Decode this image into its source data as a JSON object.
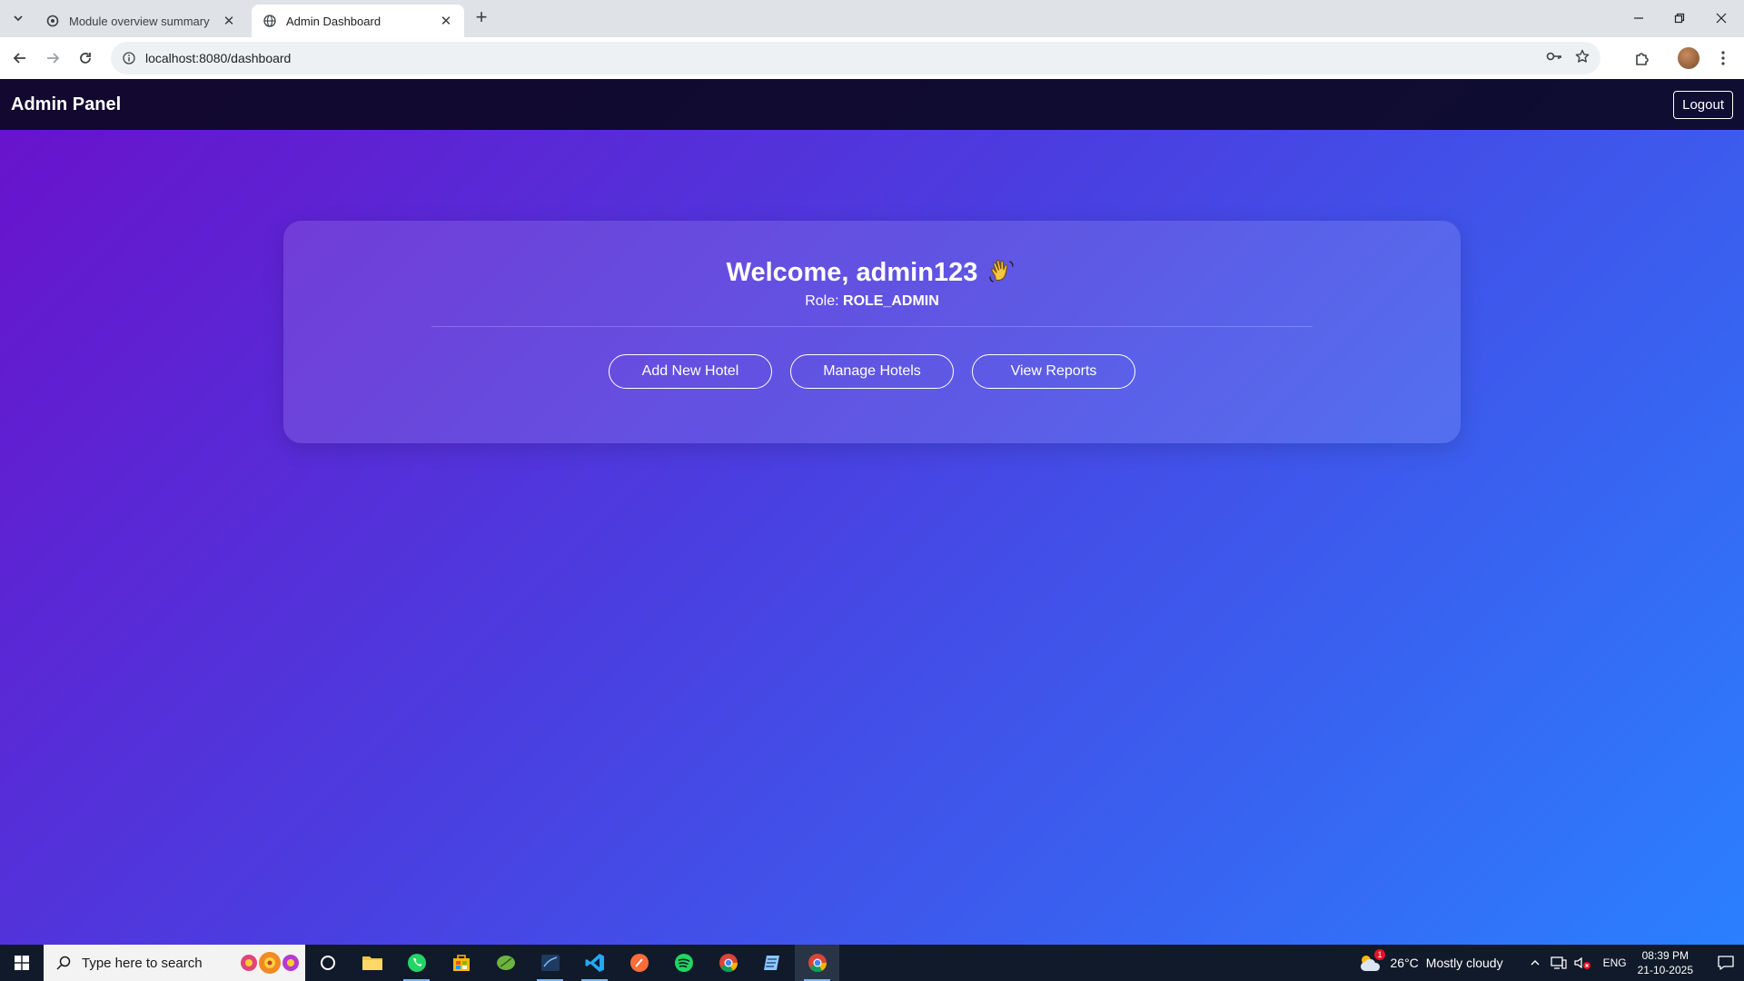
{
  "browser": {
    "tabs": [
      {
        "title": "Module overview summary",
        "active": false
      },
      {
        "title": "Admin Dashboard",
        "active": true
      }
    ],
    "url": "localhost:8080/dashboard"
  },
  "navbar": {
    "brand": "Admin Panel",
    "logout_label": "Logout"
  },
  "dashboard": {
    "welcome_text": "Welcome, admin123",
    "role_label": "Role:",
    "role_value": "ROLE_ADMIN",
    "actions": [
      {
        "label": "Add New Hotel"
      },
      {
        "label": "Manage Hotels"
      },
      {
        "label": "View Reports"
      }
    ]
  },
  "taskbar": {
    "search_placeholder": "Type here to search",
    "weather_temp": "26°C",
    "weather_desc": "Mostly cloudy",
    "weather_badge": "1",
    "language": "ENG",
    "time": "08:39 PM",
    "date": "21-10-2025"
  },
  "colors": {
    "gradient_start": "#6a11cb",
    "gradient_end": "#2a80ff",
    "navbar_bg": "#0c0823"
  }
}
